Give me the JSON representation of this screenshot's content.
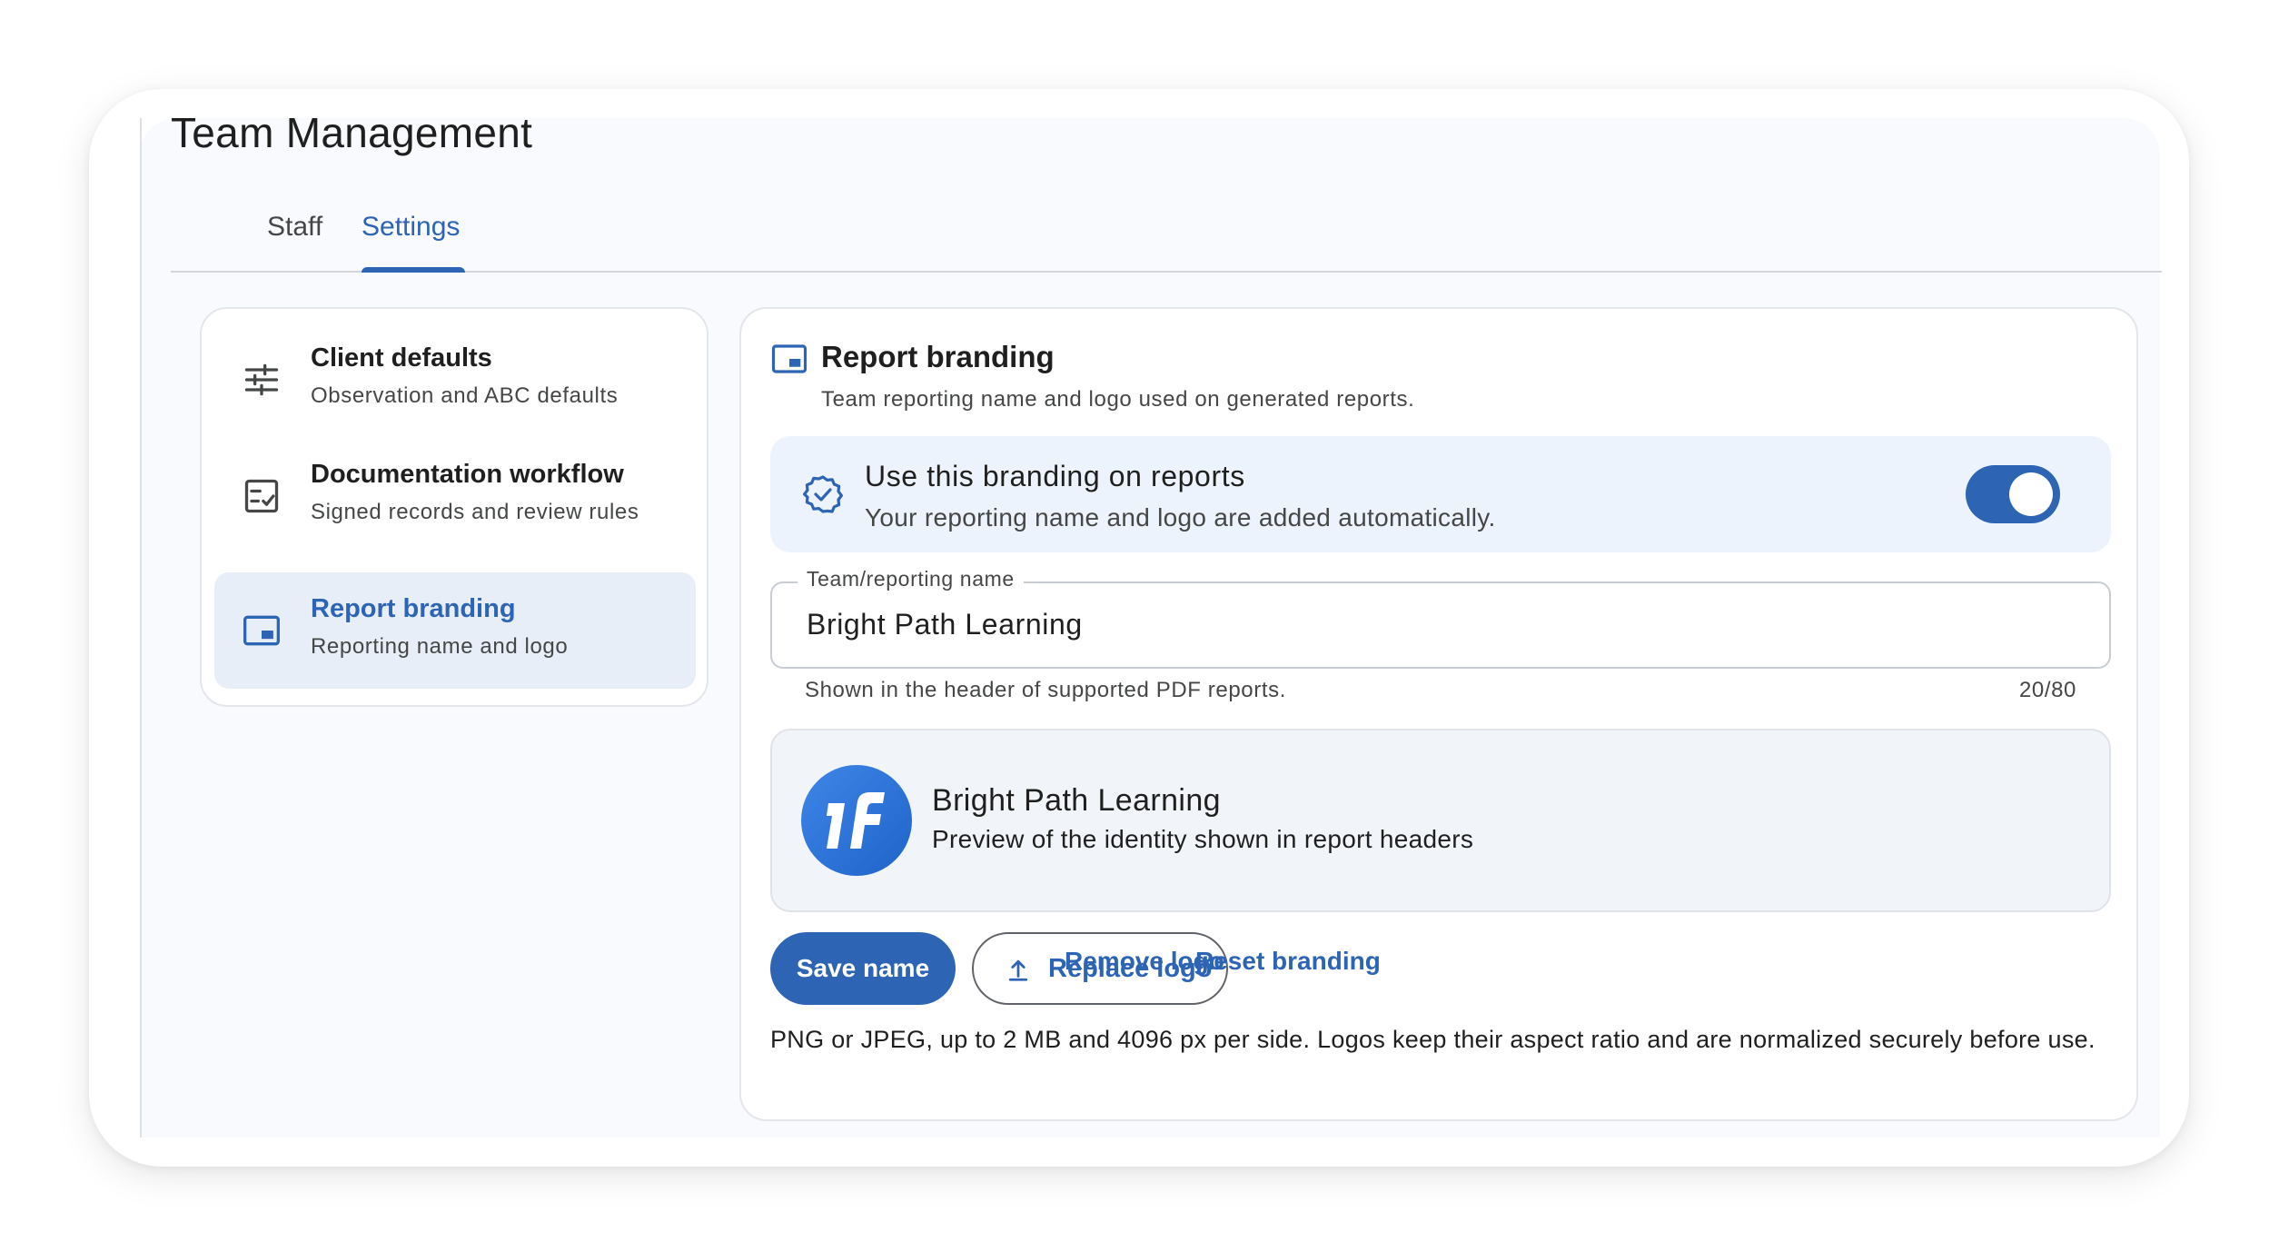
{
  "page": {
    "title": "Team Management"
  },
  "tabs": [
    {
      "label": "Staff",
      "active": false
    },
    {
      "label": "Settings",
      "active": true
    }
  ],
  "nav": {
    "items": [
      {
        "title": "Client defaults",
        "subtitle": "Observation and ABC defaults",
        "icon": "sliders-icon",
        "active": false
      },
      {
        "title": "Documentation workflow",
        "subtitle": "Signed records and review rules",
        "icon": "checklist-icon",
        "active": false
      },
      {
        "title": "Report branding",
        "subtitle": "Reporting name and logo",
        "icon": "picture-in-picture-icon",
        "active": true
      }
    ]
  },
  "branding": {
    "title": "Report branding",
    "subtitle": "Team reporting name and logo used on generated reports.",
    "toggle": {
      "title": "Use this branding on reports",
      "subtitle": "Your reporting name and logo are added automatically.",
      "enabled": true,
      "icon": "verified-badge-icon"
    },
    "name_field": {
      "label": "Team/reporting name",
      "value": "Bright Path Learning",
      "helper": "Shown in the header of supported PDF reports.",
      "counter": "20/80"
    },
    "preview": {
      "name": "Bright Path Learning",
      "caption": "Preview of the identity shown in report headers",
      "logo_icon": "team-logo-icon"
    },
    "actions": {
      "save": "Save name",
      "replace": "Replace logo",
      "remove": "Remove logo",
      "reset": "Reset branding"
    },
    "note": "PNG or JPEG, up to 2 MB and 4096 px per side. Logos keep their aspect ratio and are normalized securely before use."
  },
  "colors": {
    "accent": "#2d64b3",
    "panel": "#edf3fc",
    "background": "#f8fafd"
  }
}
